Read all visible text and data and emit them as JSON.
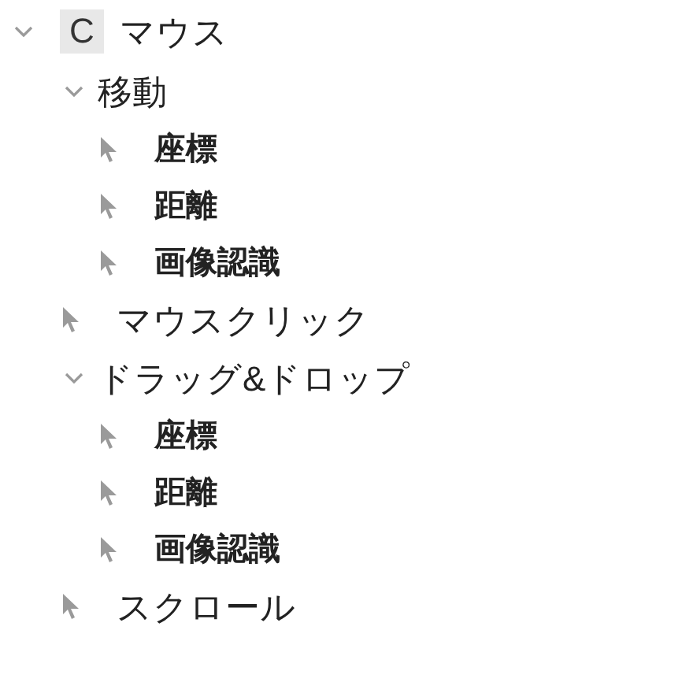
{
  "tree": [
    {
      "kind": "group",
      "icon": "C",
      "label": "マウス",
      "expanded": true,
      "children": [
        {
          "kind": "group",
          "label": "移動",
          "expanded": true,
          "children": [
            {
              "kind": "action",
              "label": "座標"
            },
            {
              "kind": "action",
              "label": "距離"
            },
            {
              "kind": "action",
              "label": "画像認識"
            }
          ]
        },
        {
          "kind": "action",
          "label": "マウスクリック"
        },
        {
          "kind": "group",
          "label": "ドラッグ&ドロップ",
          "expanded": true,
          "children": [
            {
              "kind": "action",
              "label": "座標"
            },
            {
              "kind": "action",
              "label": "距離"
            },
            {
              "kind": "action",
              "label": "画像認識"
            }
          ]
        },
        {
          "kind": "action",
          "label": "スクロール"
        }
      ]
    }
  ]
}
